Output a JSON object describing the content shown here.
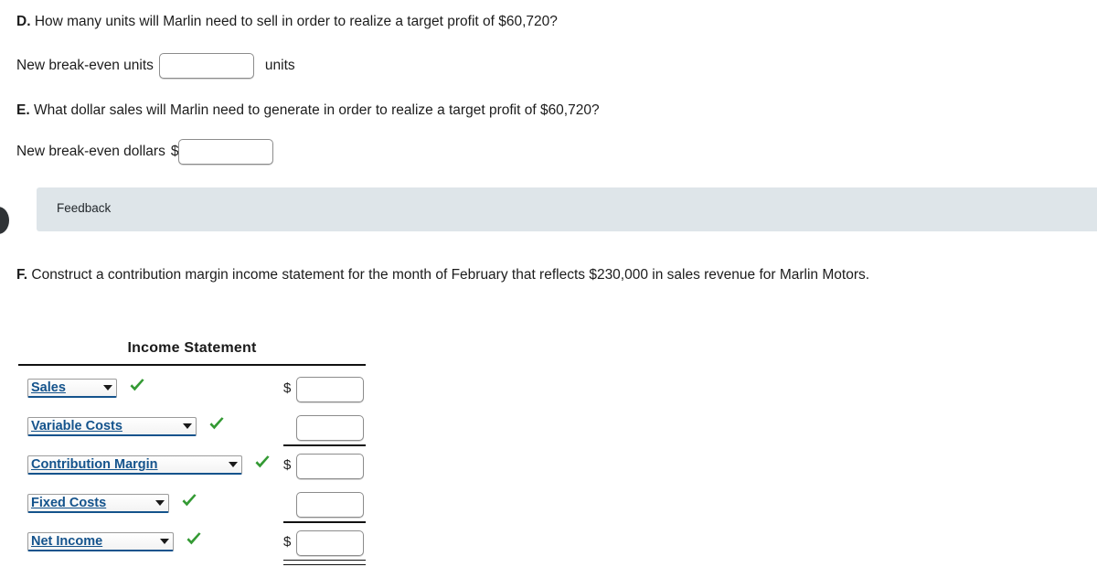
{
  "questions": [
    {
      "letter": "D.",
      "text": "How many units will Marlin need to sell in order to realize a target profit of $60,720?",
      "answer_label": "New break-even units",
      "answer_value": "",
      "answer_suffix": "units",
      "prefix_symbol": ""
    },
    {
      "letter": "E.",
      "text": "What dollar sales will Marlin need to generate in order to realize a target profit of $60,720?",
      "answer_label": "New break-even dollars",
      "answer_value": "",
      "answer_suffix": "",
      "prefix_symbol": "$"
    },
    {
      "letter": "F.",
      "text": "Construct a contribution margin income statement for the month of February that reflects $230,000 in sales revenue for Marlin Motors."
    }
  ],
  "feedback": {
    "label": "Feedback"
  },
  "statement": {
    "title": "Income Statement",
    "rows": [
      {
        "label": "Sales",
        "combo_width": 98,
        "check": true,
        "dollar": "$",
        "value": "",
        "rule": "none"
      },
      {
        "label": "Variable Costs",
        "combo_width": 185,
        "check": true,
        "dollar": "",
        "value": "",
        "rule": "single"
      },
      {
        "label": "Contribution Margin",
        "combo_width": 235,
        "check": true,
        "dollar": "$",
        "value": "",
        "rule": "none"
      },
      {
        "label": "Fixed Costs",
        "combo_width": 155,
        "check": true,
        "dollar": "",
        "value": "",
        "rule": "single"
      },
      {
        "label": "Net Income",
        "combo_width": 160,
        "check": true,
        "dollar": "$",
        "value": "",
        "rule": "double"
      }
    ]
  },
  "colors": {
    "combo_text": "#14538c",
    "check_green": "#349a34",
    "feedback_bg": "#dee5e9",
    "rule_black": "#111111"
  },
  "icons": {
    "dropdown": "chevron-down-icon",
    "correct": "green-check-icon"
  }
}
